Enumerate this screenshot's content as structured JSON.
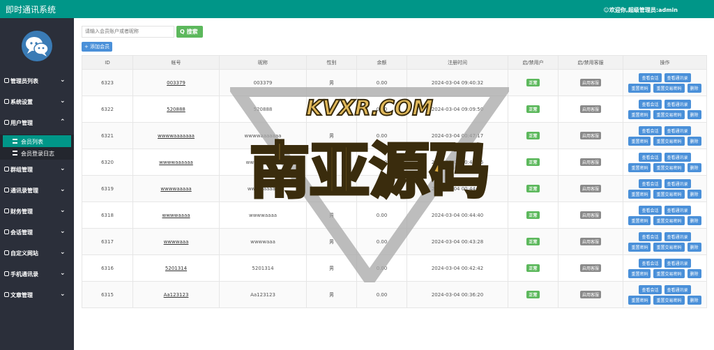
{
  "app": {
    "title": "即时通讯系统",
    "welcome": "☺欢迎你,超级管理员:admin"
  },
  "sidebar": {
    "items": [
      {
        "label": "管理员列表",
        "chevron": "⌄"
      },
      {
        "label": "系统设置",
        "chevron": "⌄"
      },
      {
        "label": "用户管理",
        "chevron": "⌃"
      },
      {
        "label": "群组管理",
        "chevron": "⌄"
      },
      {
        "label": "通讯录管理",
        "chevron": "⌄"
      },
      {
        "label": "财务管理",
        "chevron": "⌄"
      },
      {
        "label": "会话管理",
        "chevron": "⌄"
      },
      {
        "label": "自定义网站",
        "chevron": "⌄"
      },
      {
        "label": "手机通讯录",
        "chevron": "⌄"
      },
      {
        "label": "文章管理",
        "chevron": "⌄"
      }
    ],
    "subitems": [
      {
        "label": "会员列表"
      },
      {
        "label": "会员登录日志"
      }
    ]
  },
  "toolbar": {
    "search_placeholder": "请输入会员账户或者昵称",
    "search_label": "Q 搜索",
    "add_label": "+ 添加会员"
  },
  "table": {
    "headers": [
      "ID",
      "帐号",
      "昵称",
      "性别",
      "余额",
      "注册时间",
      "启/禁用户",
      "启/禁用客服",
      "操作"
    ],
    "rows": [
      {
        "id": "6323",
        "account": "003379",
        "nickname": "003379",
        "gender": "男",
        "balance": "0.00",
        "time": "2024-03-04 09:40:32",
        "status": "正常",
        "cs": "启用客服"
      },
      {
        "id": "6322",
        "account": "520888",
        "nickname": "520888",
        "gender": "",
        "balance": "0.00",
        "time": "2024-03-04 09:09:50",
        "status": "正常",
        "cs": "启用客服"
      },
      {
        "id": "6321",
        "account": "wwwwaaaaaaa",
        "nickname": "wwwwaaaaaaa",
        "gender": "男",
        "balance": "0.00",
        "time": "2024-03-04 00:47:17",
        "status": "正常",
        "cs": "启用客服"
      },
      {
        "id": "6320",
        "account": "wwwwaaaaaa",
        "nickname": "wwwwaaaaaa",
        "gender": "男",
        "balance": "0.00",
        "time": "2024-03-04 00:44:46",
        "status": "正常",
        "cs": "启用客服"
      },
      {
        "id": "6319",
        "account": "wwwwaaaaa",
        "nickname": "wwwwaaaaa",
        "gender": "男",
        "balance": "0.00",
        "time": "2024-03-04 00:44:43",
        "status": "正常",
        "cs": "启用客服"
      },
      {
        "id": "6318",
        "account": "wwwwaaaa",
        "nickname": "wwwwaaaa",
        "gender": "男",
        "balance": "0.00",
        "time": "2024-03-04 00:44:40",
        "status": "正常",
        "cs": "启用客服"
      },
      {
        "id": "6317",
        "account": "wwwwaaa",
        "nickname": "wwwwaaa",
        "gender": "男",
        "balance": "0.00",
        "time": "2024-03-04 00:43:28",
        "status": "正常",
        "cs": "启用客服"
      },
      {
        "id": "6316",
        "account": "5201314",
        "nickname": "5201314",
        "gender": "男",
        "balance": "0.00",
        "time": "2024-03-04 00:42:42",
        "status": "正常",
        "cs": "启用客服"
      },
      {
        "id": "6315",
        "account": "Aa123123",
        "nickname": "Aa123123",
        "gender": "男",
        "balance": "0.00",
        "time": "2024-03-04 00:36:20",
        "status": "正常",
        "cs": "启用客服"
      }
    ],
    "actions": [
      "查看会话",
      "查看通讯录",
      "重置密码",
      "重置交易密码",
      "删除"
    ]
  },
  "watermark": {
    "line1": "KVXR.COM",
    "line2": "南亚源码"
  },
  "colors": {
    "topbar": "#009688",
    "sidebar": "#2b2f3a",
    "primary": "#4a90d9",
    "success": "#5cb85c"
  }
}
